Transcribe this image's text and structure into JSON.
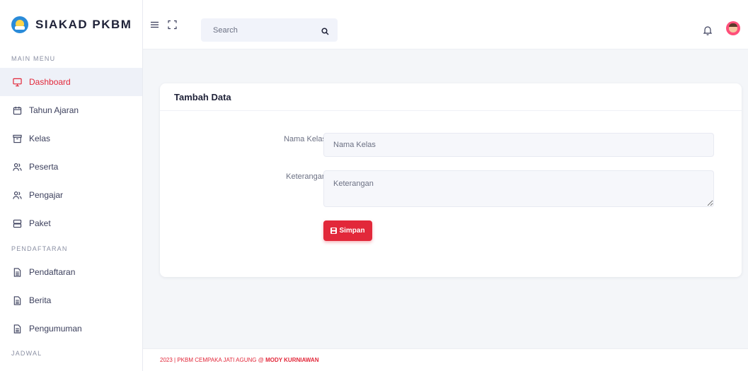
{
  "app": {
    "brand": "SIAKAD PKBM"
  },
  "sidebar": {
    "main_menu_header": "MAIN MENU",
    "main_items": [
      {
        "label": "Dashboard",
        "icon": "monitor-icon"
      },
      {
        "label": "Tahun Ajaran",
        "icon": "calendar-icon"
      },
      {
        "label": "Kelas",
        "icon": "archive-icon"
      },
      {
        "label": "Peserta",
        "icon": "users-icon"
      },
      {
        "label": "Pengajar",
        "icon": "users-icon"
      },
      {
        "label": "Paket",
        "icon": "server-icon"
      }
    ],
    "pendaftaran_header": "PENDAFTARAN",
    "pendaftaran_items": [
      {
        "label": "Pendaftaran",
        "icon": "file-icon"
      },
      {
        "label": "Berita",
        "icon": "file-icon"
      },
      {
        "label": "Pengumuman",
        "icon": "file-icon"
      }
    ],
    "jadwal_header": "JADWAL",
    "active_item": "Dashboard"
  },
  "topbar": {
    "search_placeholder": "Search"
  },
  "form": {
    "title": "Tambah Data",
    "nama_kelas_label": "Nama Kelas",
    "nama_kelas_placeholder": "Nama Kelas",
    "keterangan_label": "Keterangan",
    "keterangan_placeholder": "Keterangan",
    "submit_label": "Simpan"
  },
  "footer": {
    "text": "2023 | PKBM CEMPAKA JATI AGUNG @ ",
    "author": "MODY KURNIAWAN"
  },
  "colors": {
    "accent": "#e2283a",
    "background": "#f4f6f9",
    "sidebar_active_bg": "#eef1f8"
  }
}
